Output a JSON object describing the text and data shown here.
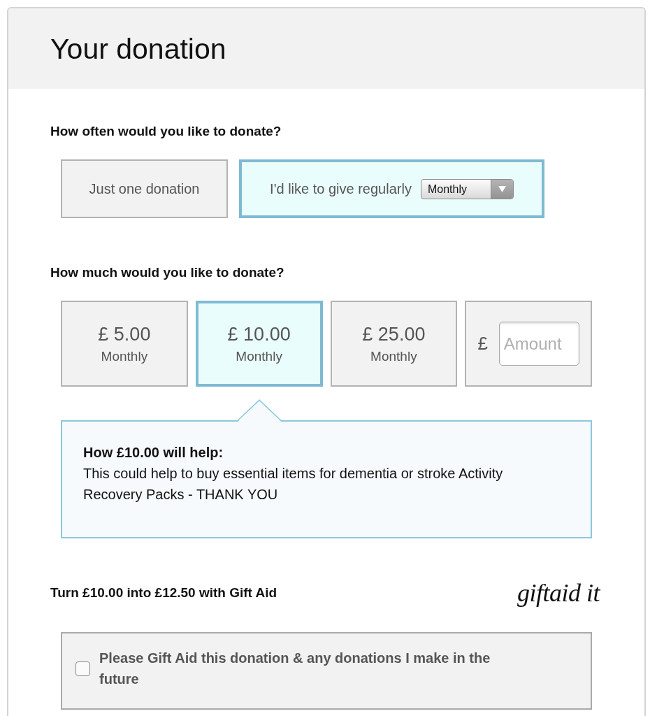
{
  "panel": {
    "title": "Your donation"
  },
  "frequency": {
    "question": "How often would you like to donate?",
    "options": [
      {
        "kind": "single",
        "label": "Just one donation",
        "selected": false
      },
      {
        "kind": "regular",
        "label": "I'd like to give regularly",
        "selected": true,
        "dropdown": {
          "value": "Monthly"
        }
      }
    ]
  },
  "amount": {
    "question": "How much would you like to donate?",
    "options": [
      {
        "kind": "preset",
        "amount": "£ 5.00",
        "period": "Monthly",
        "selected": false
      },
      {
        "kind": "preset",
        "amount": "£ 10.00",
        "period": "Monthly",
        "selected": true
      },
      {
        "kind": "preset",
        "amount": "£ 25.00",
        "period": "Monthly",
        "selected": false
      },
      {
        "kind": "custom",
        "currency": "£",
        "placeholder": "Amount",
        "selected": false
      }
    ]
  },
  "impact": {
    "heading": "How £10.00 will help:",
    "text": "This could help to buy essential items for dementia or stroke Activity Recovery Packs - THANK YOU"
  },
  "gift_aid": {
    "headline": "Turn £10.00 into £12.50 with Gift Aid",
    "logo_text": "giftaid it",
    "checkbox": {
      "label": "Please Gift Aid this donation & any donations I make in the future",
      "checked": false
    }
  }
}
